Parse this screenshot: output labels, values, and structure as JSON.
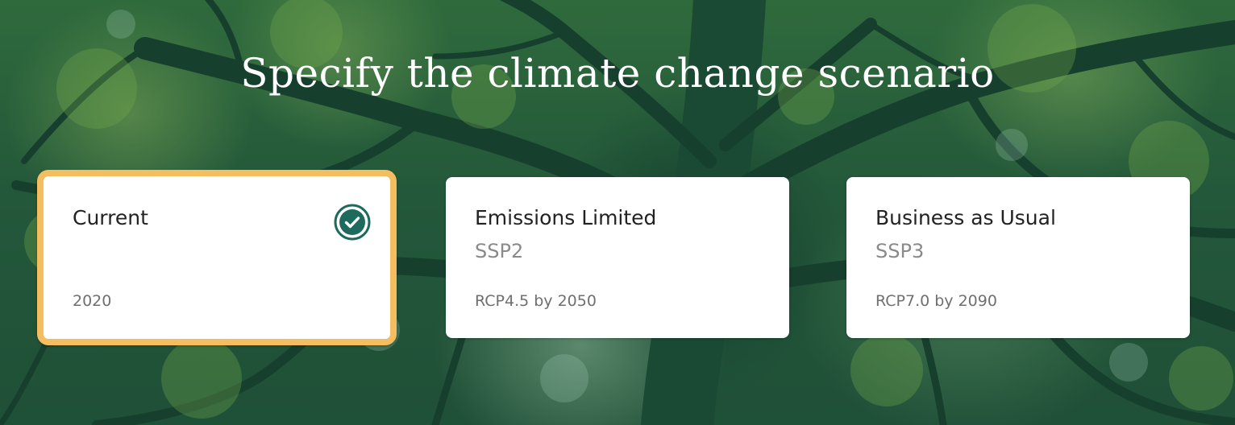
{
  "page": {
    "title": "Specify the climate change scenario"
  },
  "scenarios": [
    {
      "title": "Current",
      "subtitle": "",
      "meta": "2020",
      "selected": true
    },
    {
      "title": "Emissions Limited",
      "subtitle": "SSP2",
      "meta": "RCP4.5 by 2050",
      "selected": false
    },
    {
      "title": "Business as Usual",
      "subtitle": "SSP3",
      "meta": "RCP7.0 by 2090",
      "selected": false
    }
  ],
  "icons": {
    "selected_indicator": "check-circle-icon"
  },
  "colors": {
    "selected_border": "#f4bd5f",
    "check_icon": "#1e6b5e",
    "card_background": "#ffffff"
  }
}
